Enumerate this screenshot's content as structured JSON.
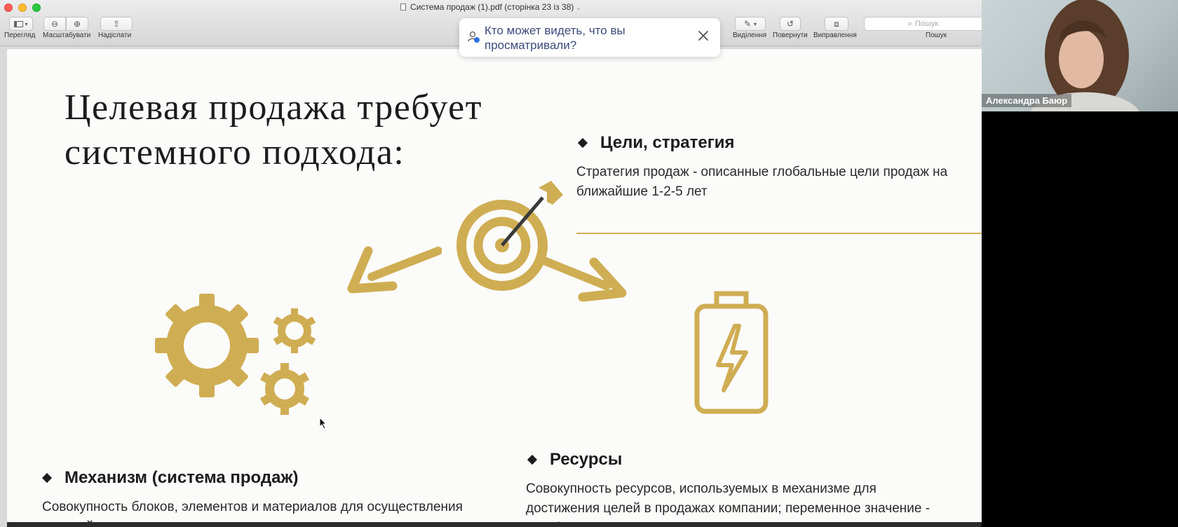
{
  "window": {
    "title": "Система продаж (1).pdf (сторінка 23 із 38)"
  },
  "toolbar": {
    "view_label": "Перегляд",
    "zoom_label": "Масштабувати",
    "share_label": "Надіслати",
    "highlight_label": "Виділення",
    "rotate_label": "Повернути",
    "markup_label": "Виправлення",
    "search_label": "Пошук",
    "search_placeholder": "Пошук"
  },
  "popup": {
    "text": "Кто может видеть, что вы просматривали?"
  },
  "slide": {
    "title_line1": "Целевая продажа требует",
    "title_line2": "системного подхода:",
    "goals": {
      "heading": "Цели, стратегия",
      "text": "Стратегия продаж - описанные глобальные цели продаж на ближайшие 1-2-5 лет"
    },
    "resources": {
      "heading": "Ресурсы",
      "line1": "Совокупность ресурсов, используемых в механизме для",
      "line2": "достижения целей в продажах компании; переменное значение -",
      "line3": "чем больше ресурсов - тем выше результат"
    },
    "mechanism": {
      "heading": "Механизм (система продаж)",
      "line1": "Совокупность блоков, элементов и материалов для осуществления",
      "line2": "целевой сделки; постоянное значение"
    },
    "accent_color": "#cfad53"
  },
  "participant": {
    "name": "Александра Баюр"
  }
}
